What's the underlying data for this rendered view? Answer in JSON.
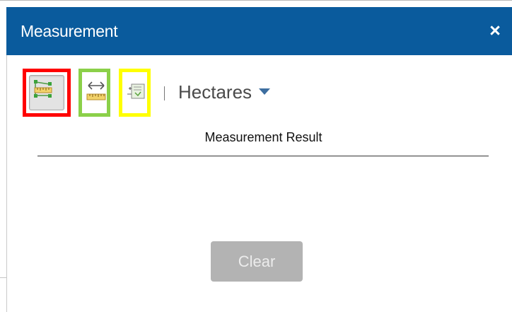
{
  "panel": {
    "title": "Measurement",
    "close_label": "×"
  },
  "toolbar": {
    "tools": [
      {
        "name": "area",
        "icon": "area-measure-icon",
        "active": true,
        "highlight": "#ff0000"
      },
      {
        "name": "distance",
        "icon": "distance-measure-icon",
        "active": false,
        "highlight": "#8bd049"
      },
      {
        "name": "location",
        "icon": "location-measure-icon",
        "active": false,
        "highlight": "#ffff00"
      }
    ],
    "unit": "Hectares"
  },
  "result": {
    "title": "Measurement Result"
  },
  "clear_button": {
    "label": "Clear",
    "enabled": false
  },
  "colors": {
    "titlebar": "#0a5b9d",
    "caret": "#3d6ea0",
    "button_disabled": "#b3b3b3"
  }
}
